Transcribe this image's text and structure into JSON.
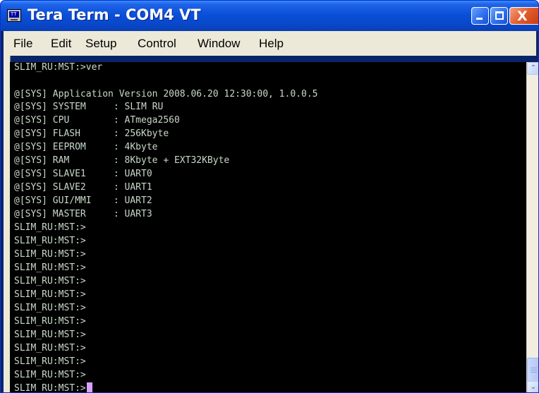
{
  "window": {
    "title": "Tera Term - COM4 VT",
    "icon_label": "TT",
    "colors": {
      "titlebar": "#0a50d8",
      "close_button": "#e15b2c",
      "terminal_background": "#000000",
      "terminal_text": "#c8d8c8",
      "cursor": "#d8a0ff"
    }
  },
  "title_buttons": {
    "minimize_icon": "minimize-icon",
    "maximize_icon": "maximize-icon",
    "close_glyph": "X"
  },
  "menu": [
    {
      "label": "File",
      "id": "file"
    },
    {
      "label": "Edit",
      "id": "edit"
    },
    {
      "label": "Setup",
      "id": "setup"
    },
    {
      "label": "Control",
      "id": "control"
    },
    {
      "label": "Window",
      "id": "window"
    },
    {
      "label": "Help",
      "id": "help"
    }
  ],
  "terminal": {
    "lines": [
      "SLIM_RU:MST:>ver",
      "",
      "@[SYS] Application Version 2008.06.20 12:30:00, 1.0.0.5",
      "@[SYS] SYSTEM     : SLIM RU",
      "@[SYS] CPU        : ATmega2560",
      "@[SYS] FLASH      : 256Kbyte",
      "@[SYS] EEPROM     : 4Kbyte",
      "@[SYS] RAM        : 8Kbyte + EXT32KByte",
      "@[SYS] SLAVE1     : UART0",
      "@[SYS] SLAVE2     : UART1",
      "@[SYS] GUI/MMI    : UART2",
      "@[SYS] MASTER     : UART3",
      "SLIM_RU:MST:>",
      "SLIM_RU:MST:>",
      "SLIM_RU:MST:>",
      "SLIM_RU:MST:>",
      "SLIM_RU:MST:>",
      "SLIM_RU:MST:>",
      "SLIM_RU:MST:>",
      "SLIM_RU:MST:>",
      "SLIM_RU:MST:>",
      "SLIM_RU:MST:>",
      "SLIM_RU:MST:>",
      "SLIM_RU:MST:>",
      "SLIM_RU:MST:>"
    ]
  },
  "scrollbar": {
    "up_glyph": "⌃",
    "down_glyph": "⌄"
  }
}
